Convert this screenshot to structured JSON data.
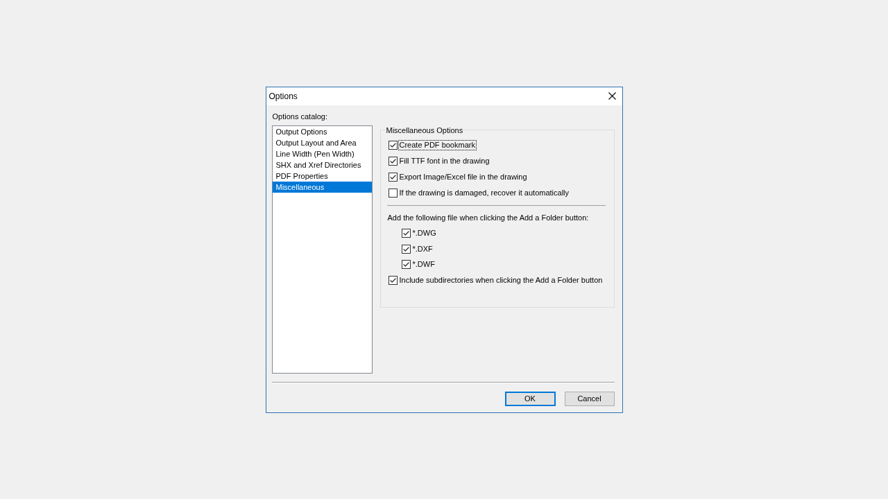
{
  "window": {
    "title": "Options"
  },
  "catalog": {
    "label": "Options catalog:",
    "items": [
      {
        "label": "Output Options",
        "selected": false
      },
      {
        "label": "Output Layout and Area",
        "selected": false
      },
      {
        "label": "Line Width (Pen Width)",
        "selected": false
      },
      {
        "label": "SHX and Xref Directories",
        "selected": false
      },
      {
        "label": "PDF Properties",
        "selected": false
      },
      {
        "label": "Miscellaneous",
        "selected": true
      }
    ]
  },
  "group": {
    "title": "Miscellaneous Options",
    "options": [
      {
        "label": "Create PDF bookmark",
        "checked": true,
        "focused": true
      },
      {
        "label": "Fill TTF font in the drawing",
        "checked": true,
        "focused": false
      },
      {
        "label": "Export Image/Excel file in the drawing",
        "checked": true,
        "focused": false
      },
      {
        "label": "If the drawing is damaged, recover it automatically",
        "checked": false,
        "focused": false
      }
    ],
    "file_types": {
      "label": "Add the following file when clicking the Add a Folder button:",
      "options": [
        {
          "label": "*.DWG",
          "checked": true,
          "focused": false
        },
        {
          "label": "*.DXF",
          "checked": true,
          "focused": false
        },
        {
          "label": "*.DWF",
          "checked": true,
          "focused": false
        }
      ]
    },
    "subdirectories": {
      "label": "Include subdirectories when clicking the Add a Folder button",
      "checked": true,
      "focused": false
    }
  },
  "buttons": [
    {
      "label": "OK",
      "default": true
    },
    {
      "label": "Cancel",
      "default": false
    }
  ]
}
